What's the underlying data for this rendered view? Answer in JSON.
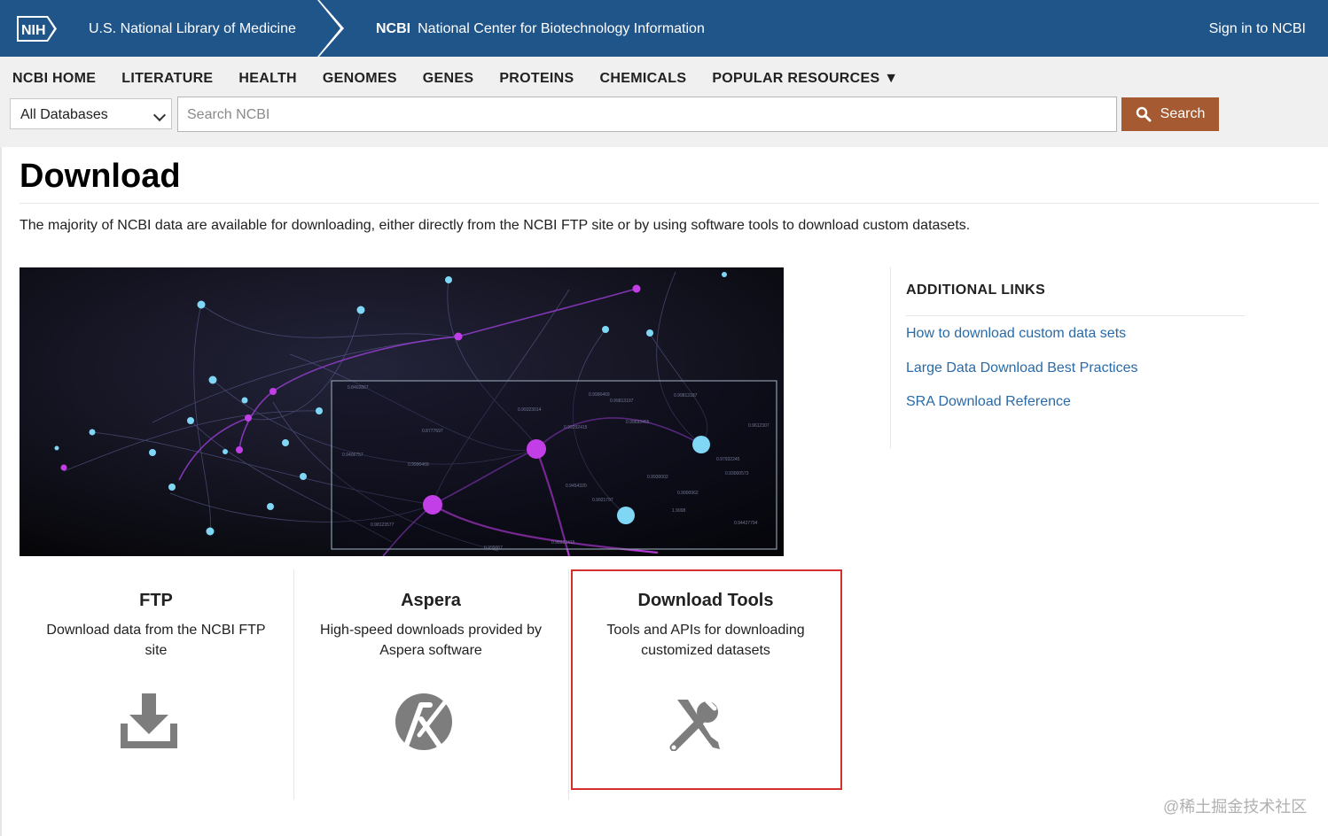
{
  "header": {
    "nih_logo": "NIH",
    "nlm_title": "U.S. National Library of Medicine",
    "ncbi_abbr": "NCBI",
    "ncbi_full": "National Center for Biotechnology Information",
    "signin": "Sign in to NCBI"
  },
  "nav": {
    "items": [
      "NCBI HOME",
      "LITERATURE",
      "HEALTH",
      "GENOMES",
      "GENES",
      "PROTEINS",
      "CHEMICALS",
      "POPULAR RESOURCES ▼"
    ]
  },
  "search": {
    "database": "All Databases",
    "placeholder": "Search NCBI",
    "button": "Search"
  },
  "page": {
    "title": "Download",
    "intro": "The majority of NCBI data are available for downloading, either directly from the NCBI FTP site or by using software tools to download custom datasets."
  },
  "additional_links": {
    "title": "ADDITIONAL LINKS",
    "links": [
      "How to download custom data sets",
      "Large Data Download Best Practices",
      "SRA Download Reference"
    ]
  },
  "cards": [
    {
      "title": "FTP",
      "desc_line1": "Download data from the NCBI FTP",
      "desc_line2": "site",
      "icon": "download-icon"
    },
    {
      "title": "Aspera",
      "desc_line1": "High-speed downloads provided by",
      "desc_line2": "Aspera software",
      "icon": "aspera-icon"
    },
    {
      "title": "Download Tools",
      "desc_line1": "Tools and APIs for downloading",
      "desc_line2": "customized datasets",
      "icon": "tools-icon"
    }
  ],
  "watermark": "@稀土掘金技术社区",
  "colors": {
    "header_blue": "#20558a",
    "search_button": "#a55a32",
    "link": "#2a6aa7",
    "highlight_border": "#d32f2f"
  }
}
